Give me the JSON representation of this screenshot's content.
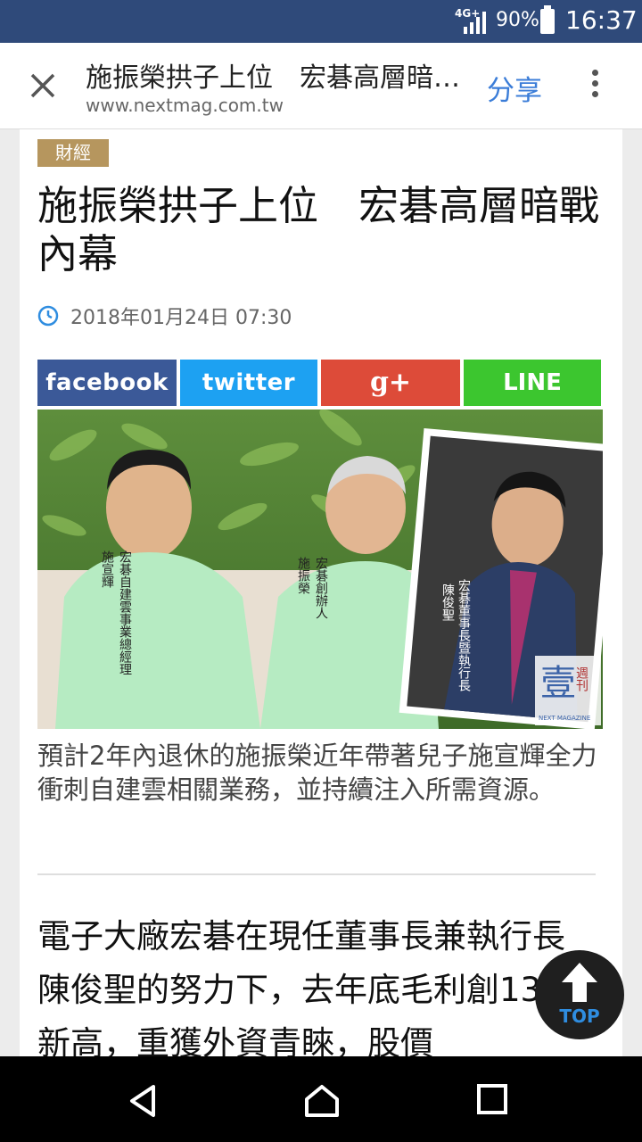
{
  "status_bar": {
    "network": "4G+",
    "battery_percent": "90%",
    "time": "16:37",
    "bg_color": "#2f4a7a"
  },
  "browser": {
    "close_icon": "close-icon",
    "page_title": "施振榮拱子上位　宏碁高層暗戰內幕",
    "url": "www.nextmag.com.tw",
    "share_label": "分享",
    "more_icon": "more-vert-icon"
  },
  "article": {
    "category": "財經",
    "title": "施振榮拱子上位　宏碁高層暗戰內幕",
    "date": "2018年01月24日 07:30",
    "share_buttons": [
      {
        "label": "facebook",
        "color": "#3b5998"
      },
      {
        "label": "twitter",
        "color": "#1da1f2"
      },
      {
        "label": "g+",
        "color": "#dd4b39"
      },
      {
        "label": "LINE",
        "color": "#3cc62f"
      }
    ],
    "photo_labels": {
      "left_title": "宏碁自建雲事業總經理",
      "left_name": "施宣輝",
      "middle_title": "宏碁創辦人",
      "middle_name": "施振榮",
      "inset_title": "宏碁董事長暨執行長",
      "inset_name": "陳俊聖",
      "watermark_main": "壹",
      "watermark_side": "週刊",
      "watermark_sub": "NEXT MAGAZINE"
    },
    "caption": "預計2年內退休的施振榮近年帶著兒子施宣輝全力衝刺自建雲相關業務，並持續注入所需資源。",
    "body": "電子大廠宏碁在現任董事長兼執行長陳俊聖的努力下，去年底毛利創13年新高，重獲外資青睞，股價"
  },
  "top_button": {
    "label": "TOP",
    "icon": "arrow-up-icon"
  },
  "nav_bar": {
    "back_icon": "back-icon",
    "home_icon": "home-icon",
    "recents_icon": "recents-icon"
  }
}
